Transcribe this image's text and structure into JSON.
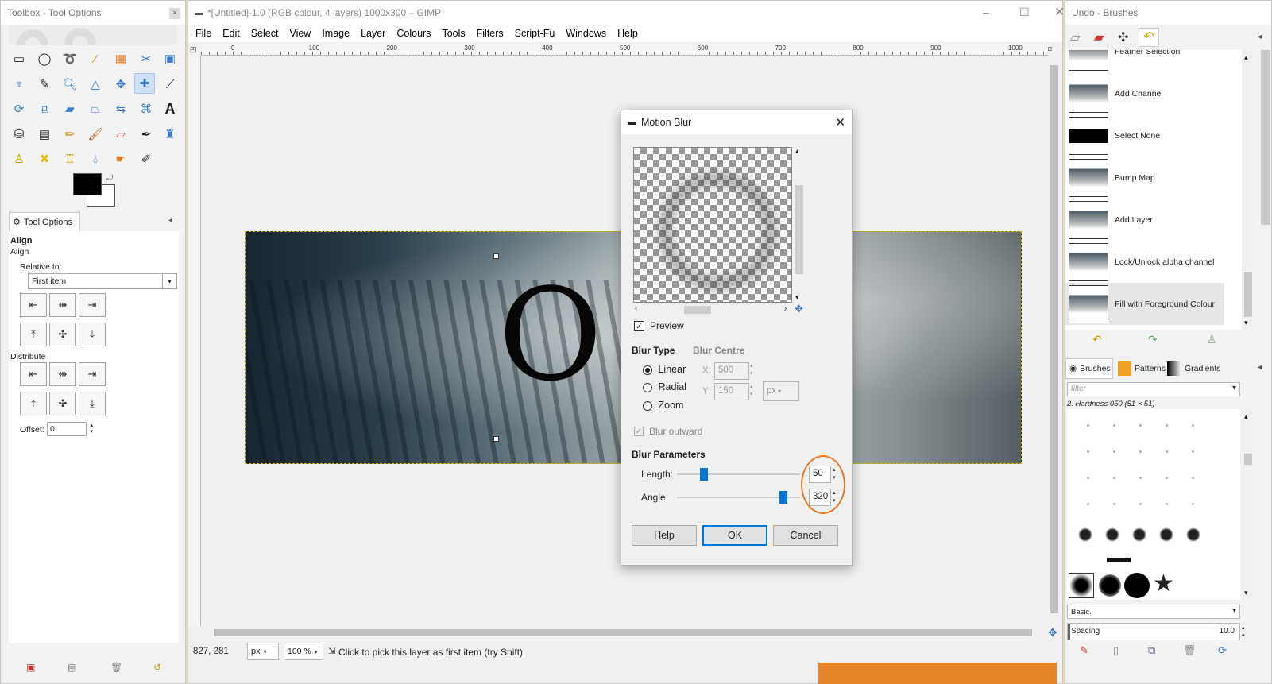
{
  "toolbox": {
    "title": "Toolbox - Tool Options",
    "tool_options_tab": "Tool Options",
    "align_header": "Align",
    "align_sub": "Align",
    "relative_to_label": "Relative to:",
    "relative_to_value": "First item",
    "distribute_label": "Distribute",
    "offset_label": "Offset:",
    "offset_value": "0"
  },
  "gimp": {
    "title": "*[Untitled]-1.0 (RGB colour, 4 layers) 1000x300 – GIMP",
    "menu": [
      "File",
      "Edit",
      "Select",
      "View",
      "Image",
      "Layer",
      "Colours",
      "Tools",
      "Filters",
      "Script-Fu",
      "Windows",
      "Help"
    ],
    "ruler_ticks": [
      "0",
      "100",
      "200",
      "300",
      "400",
      "500",
      "600",
      "700",
      "800",
      "900",
      "1000"
    ],
    "canvas_text": "O",
    "status": {
      "coords": "827, 281",
      "unit": "px",
      "zoom": "100 %",
      "message": "Click to pick this layer as first item (try Shift)"
    }
  },
  "dialog": {
    "title": "Motion Blur",
    "preview_label": "Preview",
    "blur_type_header": "Blur Type",
    "blur_centre_header": "Blur Centre",
    "types": [
      "Linear",
      "Radial",
      "Zoom"
    ],
    "selected_type": "Linear",
    "x_label": "X:",
    "x_value": "500",
    "y_label": "Y:",
    "y_value": "150",
    "unit": "px",
    "blur_outward": "Blur outward",
    "params_header": "Blur Parameters",
    "length_label": "Length:",
    "length_value": "50",
    "length_fraction": 0.2,
    "angle_label": "Angle:",
    "angle_value": "320",
    "angle_fraction": 0.89,
    "help": "Help",
    "ok": "OK",
    "cancel": "Cancel"
  },
  "undo": {
    "title": "Undo - Brushes",
    "history": [
      "Feather Selection",
      "Add Channel",
      "Select None",
      "Bump Map",
      "Add Layer",
      "Lock/Unlock alpha channel",
      "Fill with Foreground Colour"
    ],
    "tabs": [
      "Brushes",
      "Patterns",
      "Gradients"
    ],
    "filter_placeholder": "filter",
    "brush_name": "2. Hardness 050 (51 × 51)",
    "tag": "Basic.",
    "spacing_label": "Spacing",
    "spacing_value": "10.0"
  },
  "colors": {
    "accent": "#0078d7",
    "highlight": "#e87722"
  }
}
